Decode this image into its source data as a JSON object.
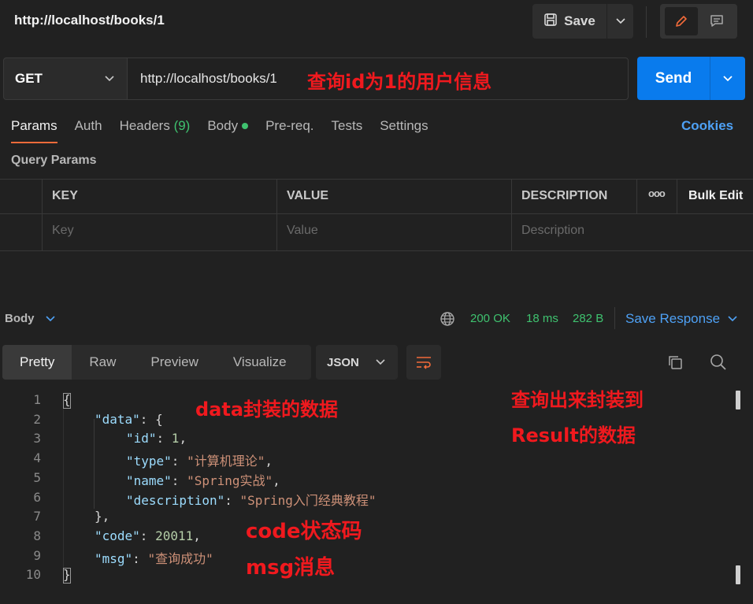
{
  "window": {
    "title": "http://localhost/books/1"
  },
  "toolbar": {
    "save_label": "Save"
  },
  "request": {
    "method": "GET",
    "url": "http://localhost/books/1",
    "send_label": "Send"
  },
  "tabs": [
    {
      "label": "Params"
    },
    {
      "label": "Auth"
    },
    {
      "label": "Headers",
      "count": "(9)"
    },
    {
      "label": "Body"
    },
    {
      "label": "Pre-req."
    },
    {
      "label": "Tests"
    },
    {
      "label": "Settings"
    }
  ],
  "cookies_label": "Cookies",
  "query_params": {
    "title": "Query Params",
    "columns": [
      "KEY",
      "VALUE",
      "DESCRIPTION"
    ],
    "more_label": "ooo",
    "bulk_edit_label": "Bulk Edit",
    "placeholders": [
      "Key",
      "Value",
      "Description"
    ]
  },
  "response": {
    "body_label": "Body",
    "status": "200 OK",
    "time": "18 ms",
    "size": "282 B",
    "save_response_label": "Save Response",
    "view_tabs": [
      "Pretty",
      "Raw",
      "Preview",
      "Visualize"
    ],
    "format": "JSON"
  },
  "code": {
    "line_numbers": [
      "1",
      "2",
      "3",
      "4",
      "5",
      "6",
      "7",
      "8",
      "9",
      "10"
    ],
    "lines": [
      {
        "indent": 0,
        "text": "{"
      },
      {
        "indent": 1,
        "key": "\"data\"",
        "punct": ": {"
      },
      {
        "indent": 2,
        "key": "\"id\"",
        "sep": ": ",
        "num": "1",
        "end": ","
      },
      {
        "indent": 2,
        "key": "\"type\"",
        "sep": ": ",
        "str": "\"计算机理论\"",
        "end": ","
      },
      {
        "indent": 2,
        "key": "\"name\"",
        "sep": ": ",
        "str": "\"Spring实战\"",
        "end": ","
      },
      {
        "indent": 2,
        "key": "\"description\"",
        "sep": ": ",
        "str": "\"Spring入门经典教程\"",
        "end": ""
      },
      {
        "indent": 1,
        "text": "},"
      },
      {
        "indent": 1,
        "key": "\"code\"",
        "sep": ": ",
        "num": "20011",
        "end": ","
      },
      {
        "indent": 1,
        "key": "\"msg\"",
        "sep": ": ",
        "str": "\"查询成功\"",
        "end": ""
      },
      {
        "indent": 0,
        "text": "}"
      }
    ]
  },
  "annotations": {
    "url_note": "查询id为1的用户信息",
    "data_note": "data封装的数据",
    "result_note_1": "查询出来封装到",
    "result_note_2": "Result的数据",
    "code_note": "code状态码",
    "msg_note": "msg消息"
  },
  "colors": {
    "accent_blue": "#097bed",
    "active_tab_underline": "#f26b3a",
    "status_green": "#3fc26f",
    "annotation_red": "#f0191e"
  }
}
